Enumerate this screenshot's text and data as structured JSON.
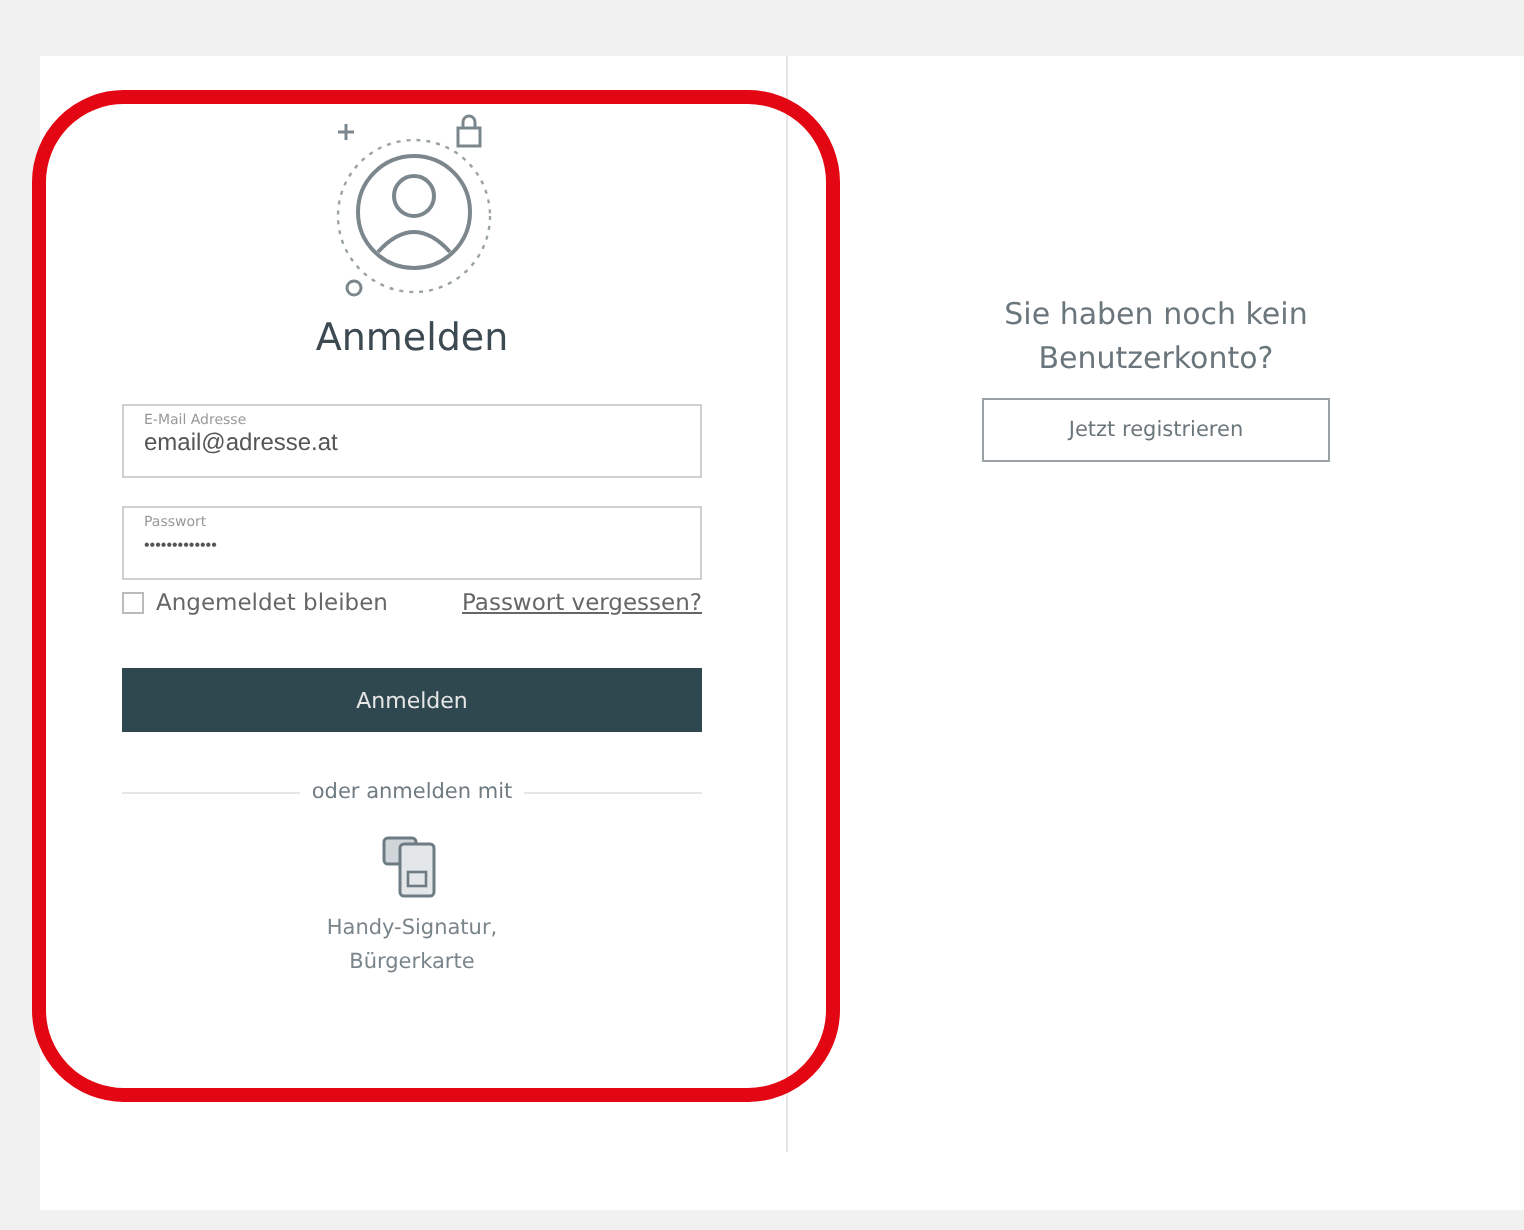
{
  "login": {
    "highlighted": true,
    "title": "Anmelden",
    "email": {
      "label": "E-Mail Adresse",
      "value": "email@adresse.at"
    },
    "password": {
      "label": "Passwort",
      "value": "•••••••••••••"
    },
    "remember": {
      "label": "Angemeldet bleiben",
      "checked": false
    },
    "forgot_link": "Passwort vergessen?",
    "submit": "Anmelden",
    "divider_text": "oder anmelden mit",
    "alt_login": "Handy-Signatur, Bürgerkarte"
  },
  "register": {
    "text": "Sie haben noch kein Benutzerkonto?",
    "button": "Jetzt registrieren"
  }
}
